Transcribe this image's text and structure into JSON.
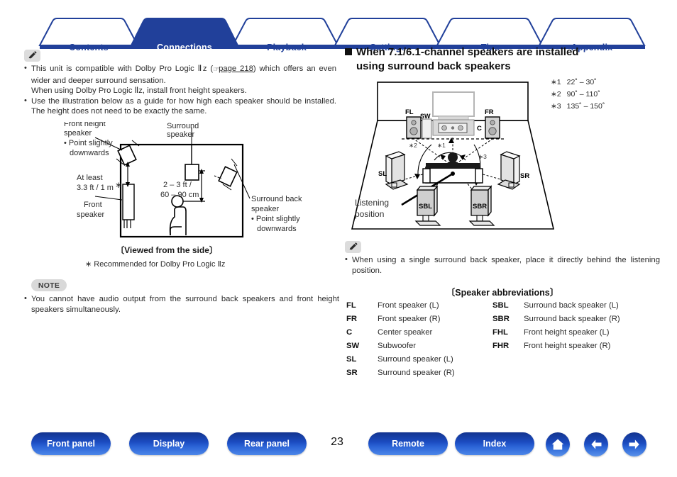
{
  "tabs": [
    {
      "label": "Contents",
      "active": false
    },
    {
      "label": "Connections",
      "active": true
    },
    {
      "label": "Playback",
      "active": false
    },
    {
      "label": "Settings",
      "active": false
    },
    {
      "label": "Tips",
      "active": false
    },
    {
      "label": "Appendix",
      "active": false
    }
  ],
  "colors": {
    "brand": "#21409a",
    "tab_active_bg": "#21409a",
    "bar": "#21409a",
    "note_badge": "#d9d9d9"
  },
  "left": {
    "icon": "pencil-icon",
    "bullets": [
      "This unit is compatible with Dolby Pro Logic Ⅱz (",
      "page 218",
      ") which offers an even wider and deeper surround sensation.",
      "When using Dolby Pro Logic Ⅱz, install front height speakers.",
      "Use the illustration below as a guide for how high each speaker should be installed. The height does not need to be exactly the same."
    ],
    "figure": {
      "label_front_height": "Front height\nspeaker",
      "label_front_height_1": "Front height",
      "label_front_height_2": "speaker",
      "label_front_height_bullet1": "• Point slightly",
      "label_front_height_bullet2": "downwards",
      "label_surround_1": "Surround",
      "label_surround_2": "speaker",
      "label_atleast_1": "At least",
      "label_atleast_2": "3.3 ft / 1 m",
      "label_atleast_star": "∗",
      "label_dist_1": "2 – 3 ft /",
      "label_dist_2": "60 – 90 cm",
      "label_front_1": "Front",
      "label_front_2": "speaker",
      "label_sb_1": "Surround back",
      "label_sb_2": "speaker",
      "label_sb_3": "• Point slightly",
      "label_sb_4": "downwards"
    },
    "caption": "〔Viewed from the side〕",
    "footnote": "∗ Recommended for Dolby Pro Logic Ⅱz",
    "note_badge": "NOTE",
    "note_text": "You cannot have audio output from the surround back speakers and front height speakers simultaneously."
  },
  "right": {
    "heading_line1": "When 7.1/6.1-channel speakers are installed",
    "heading_line2": "using surround back speakers",
    "angles": [
      {
        "mark": "∗1",
        "range": "22˚ – 30˚"
      },
      {
        "mark": "∗2",
        "range": "90˚ – 110˚"
      },
      {
        "mark": "∗3",
        "range": "135˚ – 150˚"
      }
    ],
    "figure": {
      "fl": "FL",
      "fr": "FR",
      "sw": "SW",
      "c": "C",
      "sl": "SL",
      "sr": "SR",
      "sbl": "SBL",
      "sbr": "SBR",
      "m1": "∗1",
      "m2": "∗2",
      "m3": "∗3",
      "listening_1": "Listening",
      "listening_2": "position"
    },
    "icon": "pencil-icon",
    "note_text": "When using a single surround back speaker, place it directly behind the listening position.",
    "abbr_title": "〔Speaker abbreviations〕",
    "abbr_left": [
      {
        "key": "FL",
        "val": "Front speaker (L)"
      },
      {
        "key": "FR",
        "val": "Front speaker (R)"
      },
      {
        "key": "C",
        "val": "Center speaker"
      },
      {
        "key": "SW",
        "val": "Subwoofer"
      },
      {
        "key": "SL",
        "val": "Surround speaker (L)"
      },
      {
        "key": "SR",
        "val": "Surround speaker (R)"
      }
    ],
    "abbr_right": [
      {
        "key": "SBL",
        "val": "Surround back speaker (L)"
      },
      {
        "key": "SBR",
        "val": "Surround back speaker (R)"
      },
      {
        "key": "FHL",
        "val": "Front height speaker (L)"
      },
      {
        "key": "FHR",
        "val": "Front height speaker (R)"
      }
    ]
  },
  "footer": {
    "buttons": [
      {
        "label": "Front panel"
      },
      {
        "label": "Display"
      },
      {
        "label": "Rear panel"
      },
      {
        "label": "Remote"
      },
      {
        "label": "Index"
      }
    ],
    "page_number": "23",
    "icons": [
      "home-icon",
      "arrow-left-icon",
      "arrow-right-icon"
    ]
  }
}
